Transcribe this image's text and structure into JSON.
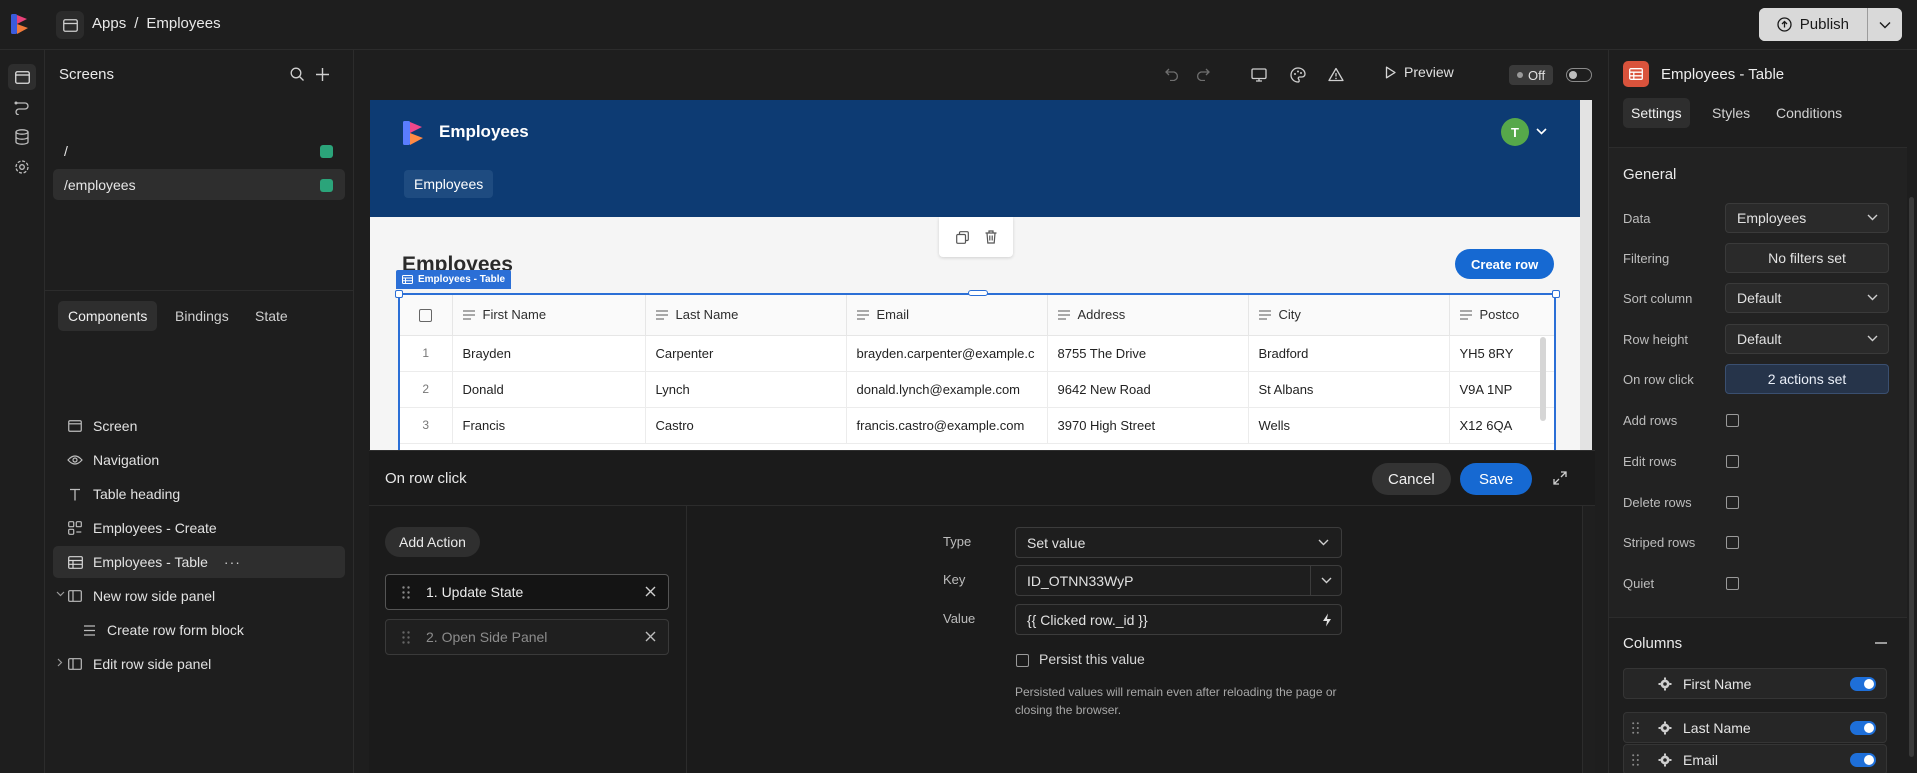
{
  "topbar": {
    "breadcrumb": [
      "Apps",
      "/",
      "Employees"
    ],
    "publish_label": "Publish"
  },
  "screens": {
    "title": "Screens",
    "items": [
      {
        "route": "/"
      },
      {
        "route": "/employees"
      }
    ]
  },
  "left_tabs": [
    "Components",
    "Bindings",
    "State"
  ],
  "component_tree": [
    {
      "label": "Screen",
      "icon": "screen-icon"
    },
    {
      "label": "Navigation",
      "icon": "eye-icon"
    },
    {
      "label": "Table heading",
      "icon": "text-icon"
    },
    {
      "label": "Employees - Create",
      "icon": "form-icon"
    },
    {
      "label": "Employees - Table",
      "icon": "table-icon",
      "more": "···"
    },
    {
      "label": "New row side panel",
      "icon": "side-panel-icon"
    },
    {
      "label": "Create row form block",
      "icon": "list-icon"
    },
    {
      "label": "Edit row side panel",
      "icon": "side-panel-icon"
    }
  ],
  "toolbar": {
    "preview_label": "Preview",
    "off_label": "Off"
  },
  "canvas": {
    "app_title": "Employees",
    "nav_tab": "Employees",
    "avatar_initial": "T",
    "page_heading": "Employees",
    "create_row_label": "Create row",
    "selected_label": "Employees - Table",
    "table": {
      "columns": [
        "First Name",
        "Last Name",
        "Email",
        "Address",
        "City",
        "Postco"
      ],
      "rows": [
        {
          "index": "1",
          "cells": [
            "Brayden",
            "Carpenter",
            "brayden.carpenter@example.c",
            "8755 The Drive",
            "Bradford",
            "YH5 8RY"
          ]
        },
        {
          "index": "2",
          "cells": [
            "Donald",
            "Lynch",
            "donald.lynch@example.com",
            "9642 New Road",
            "St Albans",
            "V9A 1NP"
          ]
        },
        {
          "index": "3",
          "cells": [
            "Francis",
            "Castro",
            "francis.castro@example.com",
            "3970 High Street",
            "Wells",
            "X12 6QA"
          ]
        }
      ]
    }
  },
  "drawer": {
    "title": "On row click",
    "cancel_label": "Cancel",
    "save_label": "Save",
    "add_action_label": "Add Action",
    "actions": [
      "1. Update State",
      "2. Open Side Panel"
    ],
    "fields": {
      "type_label": "Type",
      "type_value": "Set value",
      "key_label": "Key",
      "key_value": "ID_OTNN33WyP",
      "value_label": "Value",
      "value_value": "{{ Clicked row._id }}",
      "persist_label": "Persist this value",
      "persist_note": "Persisted values will remain even after reloading the page or closing the browser."
    }
  },
  "rightpanel": {
    "title": "Employees - Table",
    "tabs": [
      "Settings",
      "Styles",
      "Conditions"
    ],
    "general_title": "General",
    "settings": [
      {
        "label": "Data",
        "value": "Employees",
        "kind": "select"
      },
      {
        "label": "Filtering",
        "value": "No filters set",
        "kind": "button"
      },
      {
        "label": "Sort column",
        "value": "Default",
        "kind": "select"
      },
      {
        "label": "Row height",
        "value": "Default",
        "kind": "select"
      },
      {
        "label": "On row click",
        "value": "2 actions set",
        "kind": "button-active"
      },
      {
        "label": "Add rows",
        "kind": "checkbox"
      },
      {
        "label": "Edit rows",
        "kind": "checkbox"
      },
      {
        "label": "Delete rows",
        "kind": "checkbox"
      },
      {
        "label": "Striped rows",
        "kind": "checkbox"
      },
      {
        "label": "Quiet",
        "kind": "checkbox"
      }
    ],
    "columns_title": "Columns",
    "columns": [
      "First Name",
      "Last Name",
      "Email"
    ]
  },
  "colors": {
    "accent": "#1669d2",
    "app_header": "#0d3b73",
    "status_dot": "#2ba47a",
    "component_icon": "#d9533c"
  }
}
